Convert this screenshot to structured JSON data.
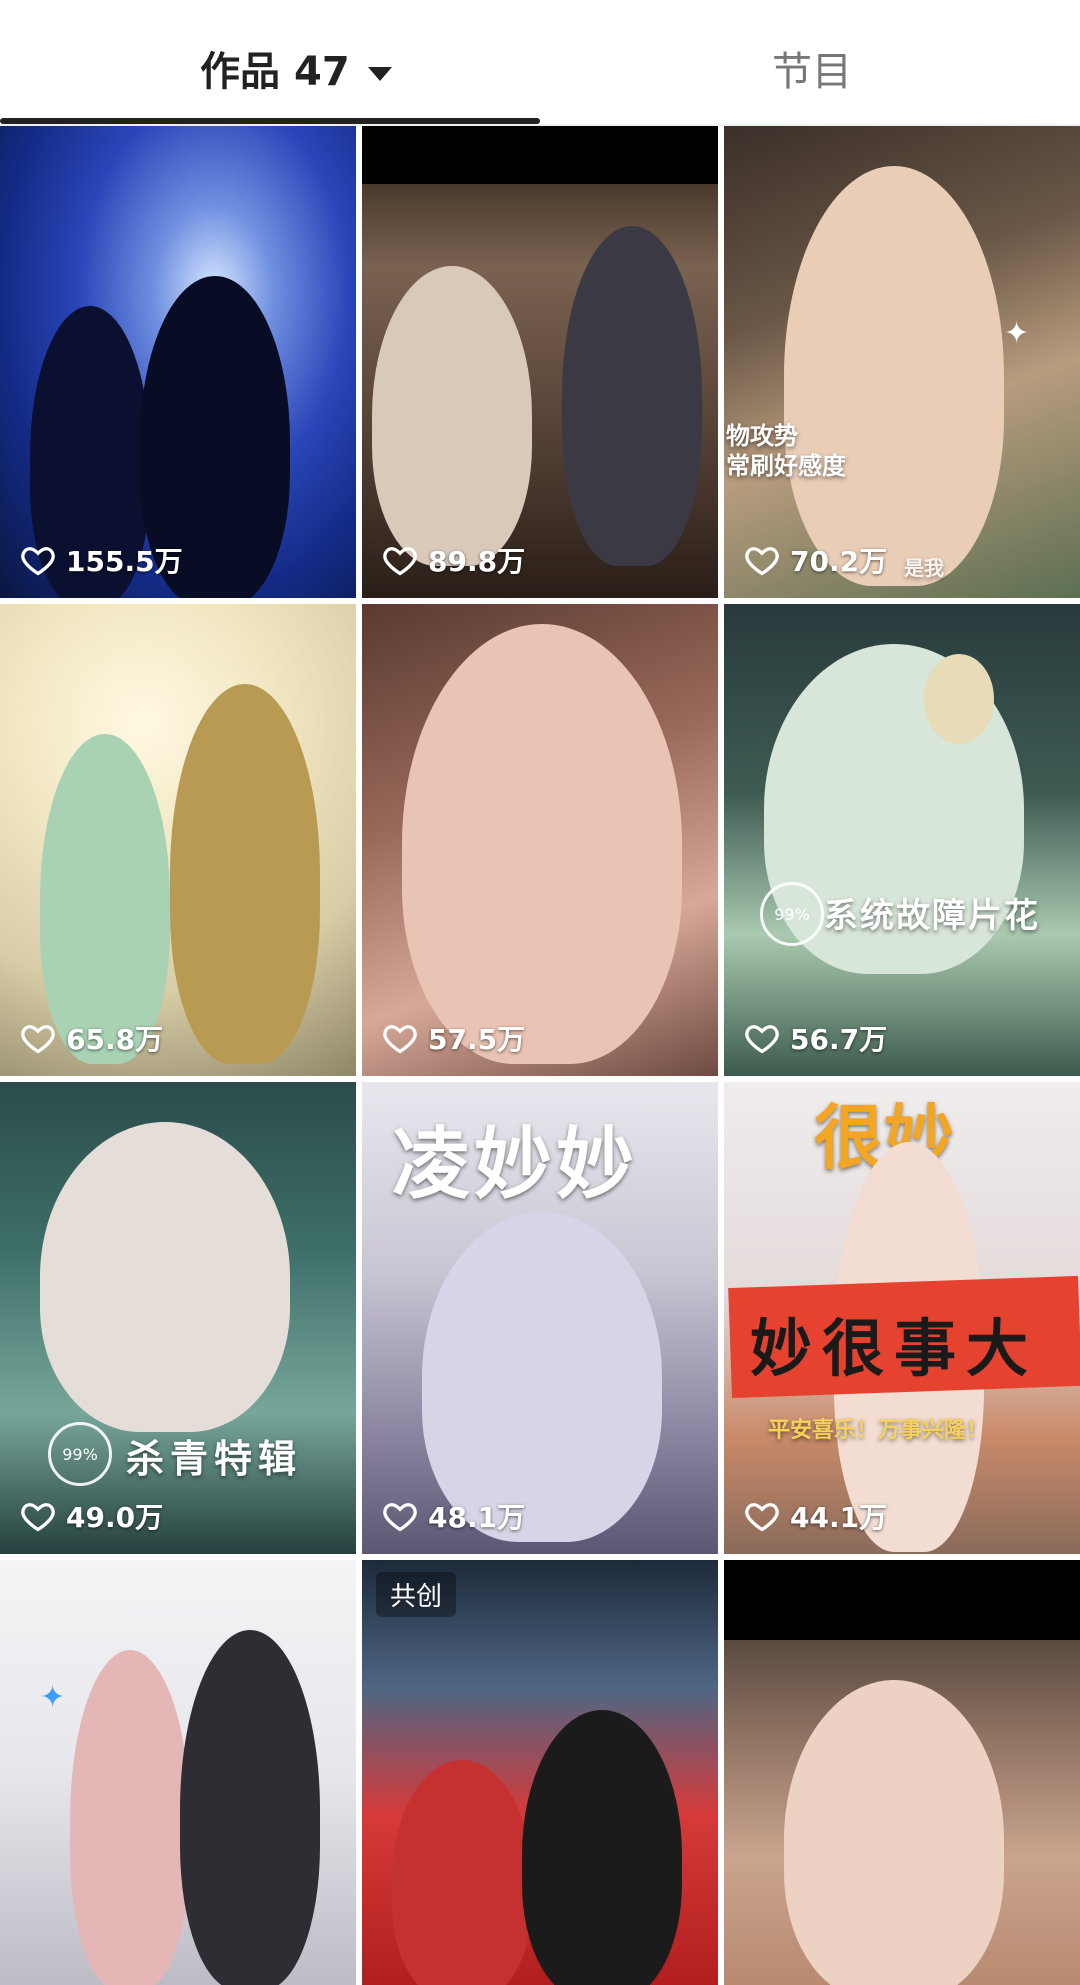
{
  "tabs": {
    "works_label": "作品",
    "works_count": "47",
    "program_label": "节目"
  },
  "grid": [
    {
      "likes": "155.5万"
    },
    {
      "likes": "89.8万"
    },
    {
      "likes": "70.2万",
      "caption_lines": [
        "物攻势",
        "常刷好感度"
      ],
      "overlay_text": "是我"
    },
    {
      "likes": "65.8万"
    },
    {
      "likes": "57.5万"
    },
    {
      "likes": "56.7万",
      "caption": "系统故障片花",
      "badge": "99%"
    },
    {
      "likes": "49.0万",
      "caption": "杀青特辑",
      "badge": "99%"
    },
    {
      "likes": "48.1万",
      "title_art": "凌妙妙"
    },
    {
      "likes": "44.1万",
      "title_art": "很妙",
      "banner": "妙很事大",
      "subtitle": "平安喜乐！万事兴隆！"
    },
    {
      "likes": ""
    },
    {
      "likes": "",
      "tag": "共创"
    },
    {
      "likes": ""
    }
  ],
  "colors": {
    "tab_active": "#222222",
    "tab_inactive": "#777777",
    "like_text": "#ffffff"
  }
}
